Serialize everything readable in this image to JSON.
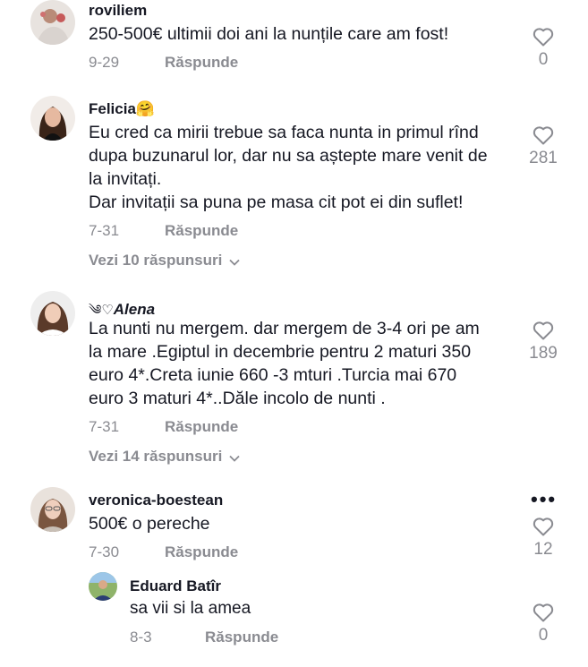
{
  "comments": [
    {
      "username": "roviliem",
      "text": "250-500€ ultimii doi ani la nunțile care am fost!",
      "date": "9-29",
      "reply_label": "Răspunde",
      "likes": "0"
    },
    {
      "username": "Felicia",
      "username_emoji": "🤗",
      "text": "Eu cred ca mirii trebue sa faca nunta in primul rînd\ndupa buzunarul lor, dar nu sa aștepte mare venit de\nla invitați.\nDar invitații sa puna pe masa cit pot ei din suflet!",
      "date": "7-31",
      "reply_label": "Răspunde",
      "likes": "281",
      "view_replies": "Vezi 10 răspunsuri"
    },
    {
      "username_prefix": "༄♡",
      "username": "Alena",
      "text": "La nunti nu mergem. dar mergem de 3-4 ori pe am\nla mare .Egiptul in decembrie pentru 2 maturi 350\neuro 4*.Creta iunie 660 -3 mturi .Turcia mai 670\neuro 3 maturi 4*..Dăle incolo de nunti .",
      "date": "7-31",
      "reply_label": "Răspunde",
      "likes": "189",
      "view_replies": "Vezi 14 răspunsuri"
    },
    {
      "username": "veronica-boestean",
      "text": "500€ o pereche",
      "date": "7-30",
      "reply_label": "Răspunde",
      "likes": "12",
      "more": "•••"
    }
  ],
  "reply": {
    "username": "Eduard Batîr",
    "text": "sa vii si la amea",
    "date": "8-3",
    "reply_label": "Răspunde",
    "likes": "0"
  }
}
